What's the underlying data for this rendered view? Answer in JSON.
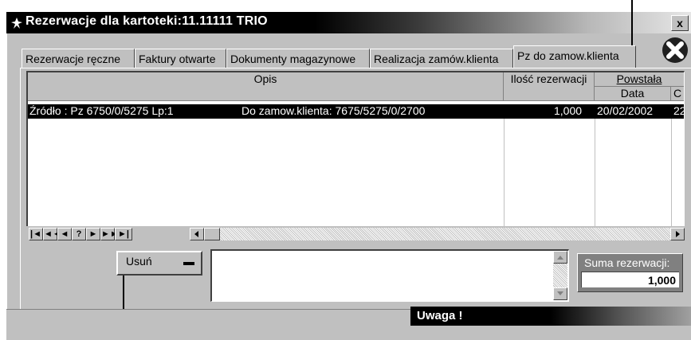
{
  "window": {
    "title": "Rezerwacje dla kartoteki:11.11111 TRIO",
    "close_label": "x"
  },
  "tabs": [
    {
      "label": "Rezerwacje ręczne"
    },
    {
      "label": "Faktury otwarte"
    },
    {
      "label": "Dokumenty magazynowe"
    },
    {
      "label": "Realizacja zamów.klienta"
    },
    {
      "label": "Pz do zamow.klienta",
      "active": true
    }
  ],
  "table": {
    "headers": {
      "opis": "Opis",
      "ilosc": "Ilość rezerwacji",
      "powstala": "Powstała",
      "data": "Data",
      "extra": "C"
    },
    "rows": [
      {
        "opis_zrodlo": "Źródło :  Pz  6750/0/5275  Lp:1",
        "opis_zamow": "Do zamow.klienta:  7675/5275/0/2700",
        "ilosc": "1,000",
        "data": "20/02/2002",
        "extra": "22"
      }
    ]
  },
  "navigator": [
    "|◄",
    "◄◄",
    "◄",
    "?",
    "►",
    "►►",
    "►|"
  ],
  "actions": {
    "delete_label": "Usuń"
  },
  "summary": {
    "label": "Suma rezerwacji:",
    "value": "1,000"
  },
  "dialog": {
    "title": "Uwaga !"
  }
}
